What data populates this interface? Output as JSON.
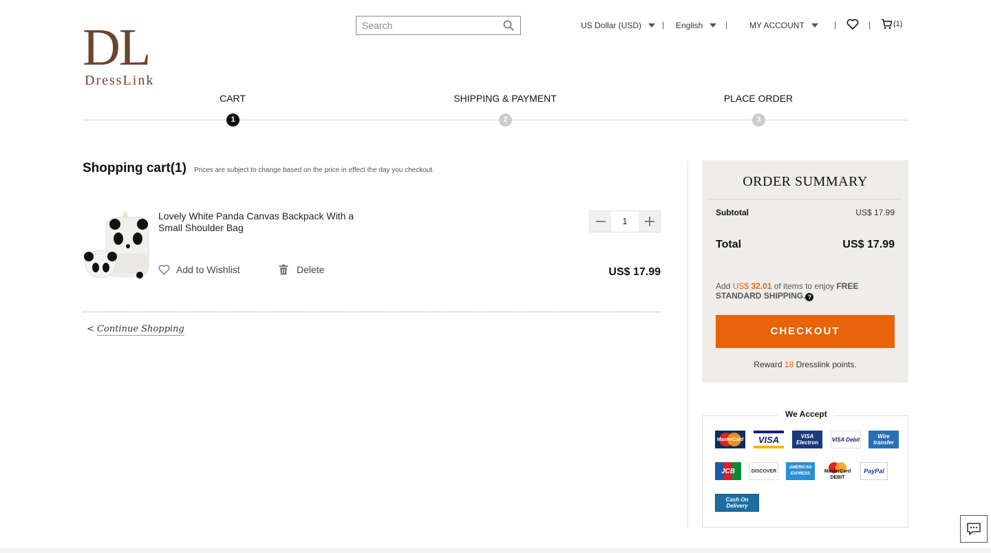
{
  "brand": {
    "mark": "DL",
    "name": "DressLink",
    "color": "#6b4530"
  },
  "header": {
    "search_placeholder": "Search",
    "currency": "US Dollar (USD)",
    "language": "English",
    "account": "MY ACCOUNT",
    "separator": "|",
    "cart_count": "(1)",
    "icons": {
      "search": "search-icon",
      "wishlist": "heart-icon",
      "cart": "cart-icon"
    }
  },
  "steps": [
    {
      "label": "CART",
      "number": "1",
      "active": true
    },
    {
      "label": "SHIPPING & PAYMENT",
      "number": "2",
      "active": false
    },
    {
      "label": "PLACE ORDER",
      "number": "3",
      "active": false
    }
  ],
  "cart": {
    "title": "Shopping cart(1)",
    "note": "Prices are subject to change based on the price in effect the day you checkout.",
    "items": [
      {
        "name": "Lovely White Panda Canvas Backpack With a Small Shoulder Bag",
        "wishlist_label": "Add to Wishlist",
        "delete_label": "Delete",
        "quantity": "1",
        "price": "US$ 17.99"
      }
    ],
    "continue_prefix": "<",
    "continue_label": "Continue Shopping"
  },
  "summary": {
    "title": "ORDER SUMMARY",
    "subtotal_label": "Subtotal",
    "subtotal_value": "US$ 17.99",
    "total_label": "Total",
    "total_value": "US$ 17.99",
    "shipping_prefix": "Add ",
    "shipping_currency": "US$ ",
    "shipping_amount": "32.01",
    "shipping_middle": " of items to enjoy ",
    "shipping_bold": "FREE STANDARD SHIPPING.",
    "help_glyph": "?",
    "checkout_label": "CHECKOUT",
    "reward_prefix": "Reward ",
    "reward_points": "18",
    "reward_suffix": " Dresslink points.",
    "accent": "#e8630a"
  },
  "payments": {
    "title": "We Accept",
    "methods": [
      {
        "label": "MasterCard"
      },
      {
        "label": "VISA"
      },
      {
        "label": "VISA Electron"
      },
      {
        "label": "VISA Debit"
      },
      {
        "label": "Wire transfer"
      },
      {
        "label": "JCB"
      },
      {
        "label": "DISCOVER"
      },
      {
        "label": "AMERICAN EXPRESS"
      },
      {
        "label": "MasterCard DEBIT"
      },
      {
        "label": "PayPal"
      },
      {
        "label": "Cash On Delivery"
      }
    ]
  }
}
